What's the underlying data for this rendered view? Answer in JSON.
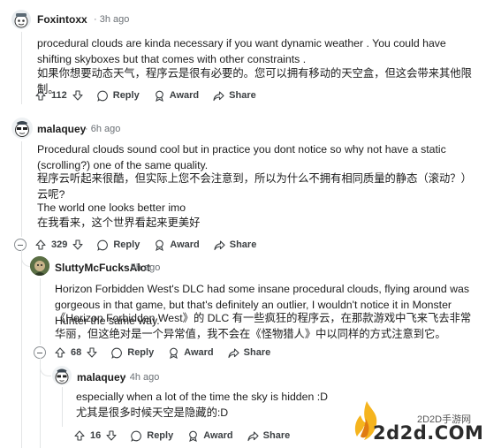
{
  "comments": [
    {
      "author": "Foxintoxx",
      "time": "3h ago",
      "text_en": "procedural clouds are kinda necessary if you want dynamic weather . You could have shifting skyboxes but that comes with other constraints .",
      "text_zh": "如果你想要动态天气，程序云是很有必要的。您可以拥有移动的天空盒，但这会带来其他限制。",
      "votes": "112",
      "reply": "Reply",
      "award": "Award",
      "share": "Share"
    },
    {
      "author": "malaquey",
      "time": "6h ago",
      "text_en": "Procedural clouds sound cool but in practice you dont notice so why not have a static (scrolling?) one of the same quality.",
      "text_zh": "程序云听起来很酷，但实际上您不会注意到，所以为什么不拥有相同质量的静态（滚动？）云呢?",
      "text_en2": "The world one looks better imo",
      "text_zh2": "在我看来，这个世界看起来更美好",
      "votes": "329",
      "reply": "Reply",
      "award": "Award",
      "share": "Share"
    },
    {
      "author": "SluttyMcFucksAlot",
      "time": "5h ago",
      "text_en": "Horizon Forbidden West's DLC had some insane procedural clouds, flying around was gorgeous in that game, but that's definitely an outlier, I wouldn't notice it in Monster Hunter the same way.",
      "text_zh": "《Horizon Forbidden West》的 DLC 有一些疯狂的程序云，在那款游戏中飞来飞去非常华丽，但这绝对是一个异常值，我不会在《怪物猎人》中以同样的方式注意到它。",
      "votes": "68",
      "reply": "Reply",
      "award": "Award",
      "share": "Share"
    },
    {
      "author": "malaquey",
      "time": "4h ago",
      "text_en": "especially when a lot of the time the sky is hidden :D",
      "text_zh": "尤其是很多时候天空是隐藏的:D",
      "votes": "16",
      "reply": "Reply",
      "award": "Award",
      "share": "Share"
    }
  ],
  "sep": "·",
  "watermark": {
    "site": "2D2D手游网",
    "domain": "2d2d.COM"
  },
  "colors": {
    "text": "#1c1c1c",
    "meta": "#6b7075",
    "thread_line": "#e3e5e6",
    "watermark": "#333333"
  }
}
